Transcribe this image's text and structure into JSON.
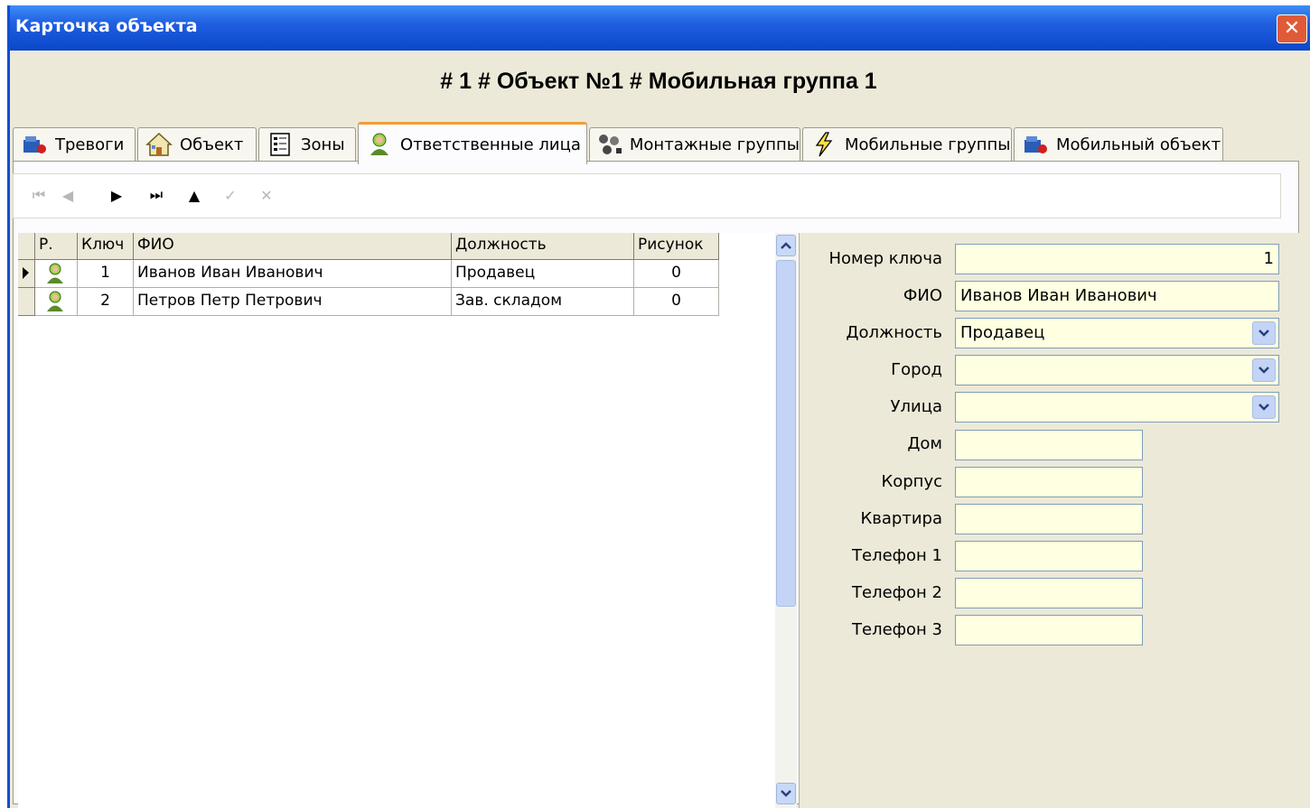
{
  "window": {
    "title": "Карточка объекта",
    "close_glyph": "✕"
  },
  "header": {
    "title": "# 1 # Объект №1 # Мобильная группа 1"
  },
  "tabs": [
    {
      "label": "Тревоги",
      "icon": "alarm-icon"
    },
    {
      "label": "Объект",
      "icon": "house-icon"
    },
    {
      "label": "Зоны",
      "icon": "zones-icon"
    },
    {
      "label": "Ответственные лица",
      "icon": "person-icon",
      "active": true
    },
    {
      "label": "Монтажные группы",
      "icon": "install-group-icon"
    },
    {
      "label": "Мобильные группы",
      "icon": "lightning-icon"
    },
    {
      "label": "Мобильный объект",
      "icon": "mobile-object-icon"
    }
  ],
  "grid": {
    "columns": [
      "Р.",
      "Ключ",
      "ФИО",
      "Должность",
      "Рисунок"
    ],
    "rows": [
      {
        "key": "1",
        "name": "Иванов Иван Иванович",
        "position": "Продавец",
        "picture": "0"
      },
      {
        "key": "2",
        "name": "Петров Петр Петрович",
        "position": "Зав. складом",
        "picture": "0"
      }
    ]
  },
  "form": {
    "key_label": "Номер ключа",
    "key_value": "1",
    "name_label": "ФИО",
    "name_value": "Иванов Иван Иванович",
    "position_label": "Должность",
    "position_value": "Продавец",
    "city_label": "Город",
    "city_value": "",
    "street_label": "Улица",
    "street_value": "",
    "house_label": "Дом",
    "house_value": "",
    "building_label": "Корпус",
    "building_value": "",
    "apartment_label": "Квартира",
    "apartment_value": "",
    "phone1_label": "Телефон 1",
    "phone1_value": "",
    "phone2_label": "Телефон 2",
    "phone2_value": "",
    "phone3_label": "Телефон 3",
    "phone3_value": ""
  },
  "colors": {
    "title_bar": "#1f5fe0",
    "field_bg": "#ffffe1",
    "active_tab_accent": "#f0a030",
    "window_bg": "#ece9d8"
  }
}
